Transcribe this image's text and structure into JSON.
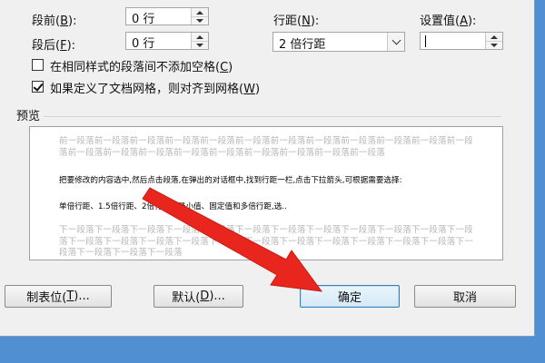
{
  "spacing": {
    "before_label": "段前(",
    "before_key": "B",
    "before_suffix": "):",
    "before_value": "0 行",
    "after_label": "段后(",
    "after_key": "F",
    "after_suffix": "):",
    "after_value": "0 行",
    "line_spacing_label": "行距(",
    "line_spacing_key": "N",
    "line_spacing_suffix": "):",
    "line_spacing_value": "2 倍行距",
    "setting_label": "设置值(",
    "setting_key": "A",
    "setting_suffix": "):",
    "setting_value": ""
  },
  "options": {
    "no_space_label": "在相同样式的段落间不添加空格(",
    "no_space_key": "C",
    "no_space_suffix": ")",
    "no_space_checked": false,
    "snap_grid_label": "如果定义了文档网格，则对齐到网格(",
    "snap_grid_key": "W",
    "snap_grid_suffix": ")",
    "snap_grid_checked": true
  },
  "preview": {
    "title": "预览",
    "previous_paragraph": "前一段落前一段落前一段落前一段落前一段落前一段落前一段落前一段落前一段落前一段落前一段落前一段落前一段落前一段落前一段落前一段落前一段落前一段落前一段落前一段落前一段落",
    "current_line1": "把要修改的内容选中,然后点击段落,在弹出的对话框中,找到行距一栏,点击下拉箭头,可根据需要选择:",
    "current_line2": "单倍行距、1.5倍行距、2倍行距、最小值、固定值和多倍行距,选..",
    "next_paragraph": "下一段落下一段落下一段落下一段落下一段落下一段落下一段落下一段落下一段落下一段落下一段落下一段落下一段落下一段落下一段落下一段落下一段落下一段落下一段落下一段落下一段落下一段落下一段落下一段落下一段落下一段落下一段落"
  },
  "buttons": {
    "tabs_label": "制表位(",
    "tabs_key": "T",
    "tabs_suffix": ")...",
    "default_label": "默认(",
    "default_key": "D",
    "default_suffix": ")...",
    "ok_label": "确定",
    "cancel_label": "取消"
  },
  "colors": {
    "desktop": "#4f8fd2",
    "arrow": "#e8261e",
    "dialog": "#f0f0f0"
  },
  "icons": [
    "spin-up-icon",
    "spin-down-icon",
    "dropdown-chevron-icon",
    "checkbox-checked-icon",
    "annotation-arrow-icon"
  ]
}
